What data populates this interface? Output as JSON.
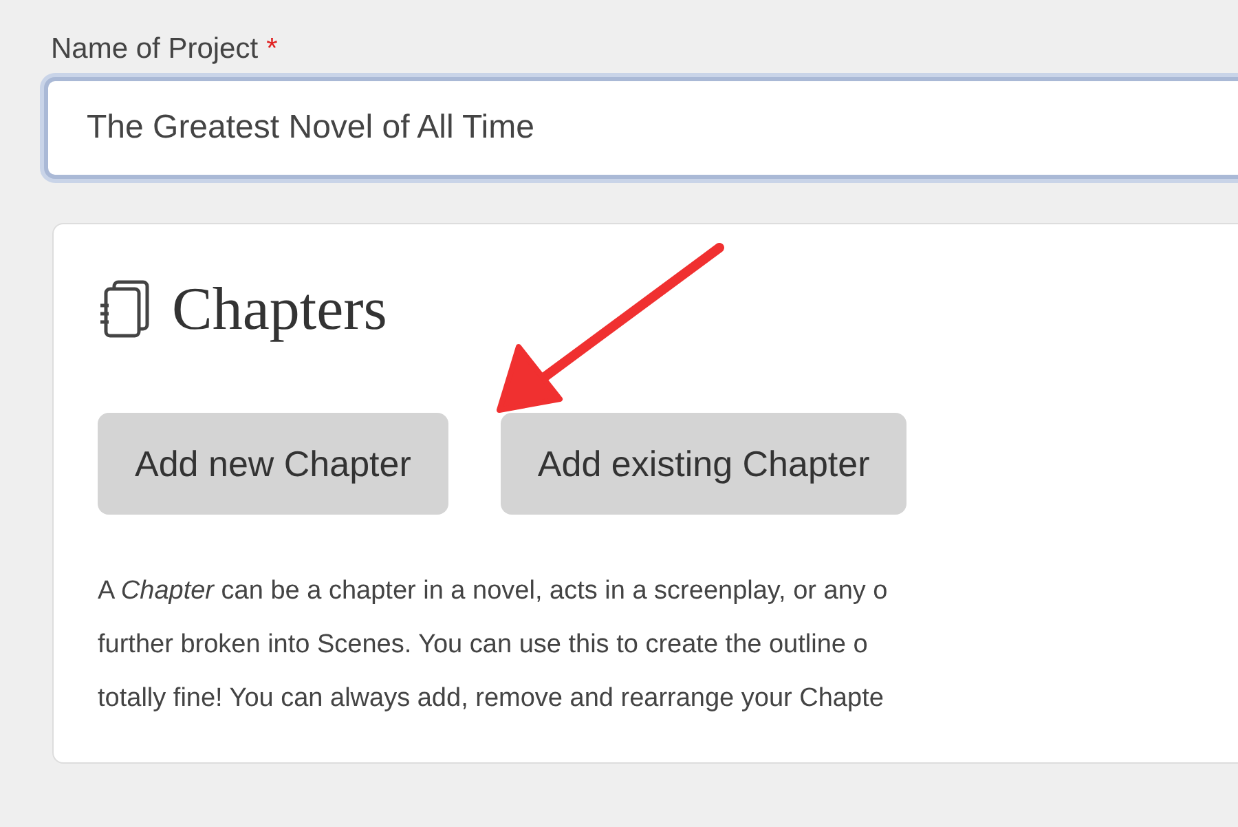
{
  "field": {
    "label": "Name of Project",
    "required_mark": "*",
    "value": "The Greatest Novel of All Time"
  },
  "chapters": {
    "title": "Chapters",
    "buttons": [
      "Add new Chapter",
      "Add existing Chapter"
    ],
    "description_lines": [
      "A *Chapter* can be a chapter in a novel, acts in a screenplay, or any o",
      "further broken into Scenes. You can use this to create the outline o",
      "totally fine! You can always add, remove and rearrange your Chapte"
    ]
  }
}
